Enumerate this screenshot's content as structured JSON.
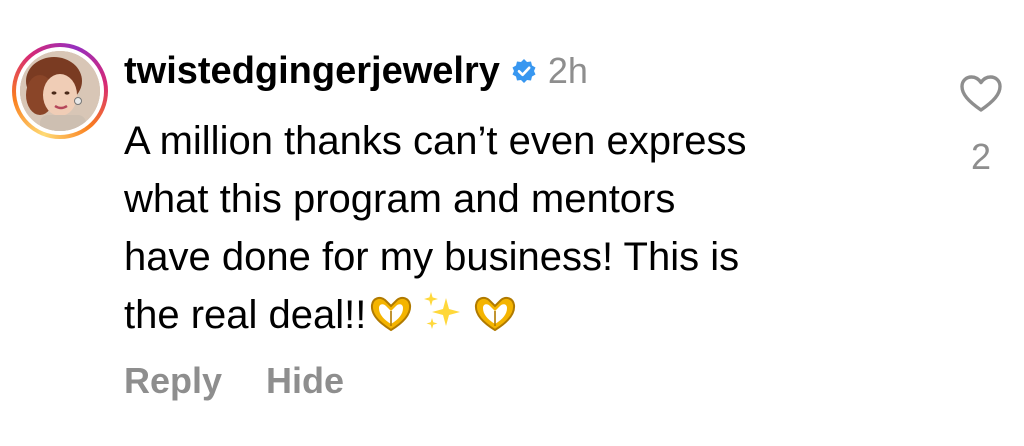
{
  "comment": {
    "username": "twistedgingerjewelry",
    "verified": true,
    "timestamp": "2h",
    "text_lines": [
      "A million thanks can’t even express",
      "what this program and mentors",
      "have done for my business! This is",
      "the real deal!!"
    ],
    "emojis": [
      "heart-hands-emoji",
      "sparkles-emoji",
      "heart-hands-emoji"
    ],
    "like_count": "2",
    "actions": {
      "reply_label": "Reply",
      "hide_label": "Hide"
    }
  },
  "colors": {
    "text": "#000000",
    "muted": "#8e8e8e",
    "verified_blue": "#3897f0",
    "emoji_gold": "#f4b400"
  }
}
